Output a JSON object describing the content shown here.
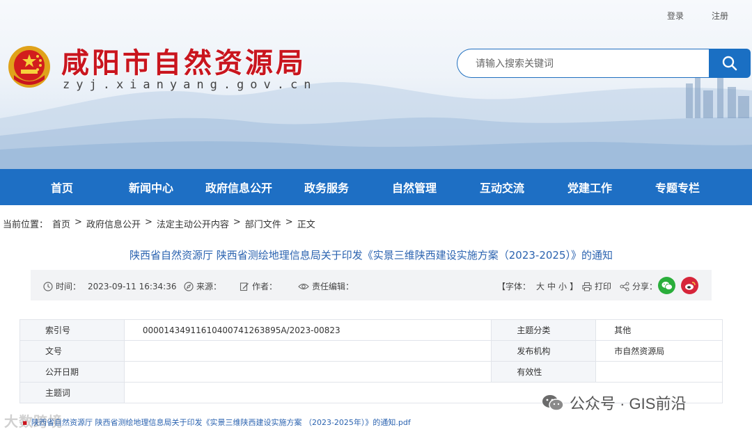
{
  "toplinks": {
    "login": "登录",
    "register": "注册"
  },
  "site": {
    "title": "咸阳市自然资源局",
    "domain": "zyj.xianyang.gov.cn"
  },
  "search": {
    "placeholder": "请输入搜索关键词",
    "icon": "search-icon"
  },
  "nav": {
    "items": [
      "首页",
      "新闻中心",
      "政府信息公开",
      "政务服务",
      "自然管理",
      "互动交流",
      "党建工作",
      "专题专栏"
    ]
  },
  "breadcrumb": {
    "label": "当前位置：",
    "items": [
      "首页",
      "政府信息公开",
      "法定主动公开内容",
      "部门文件",
      "正文"
    ],
    "sep": ">"
  },
  "article": {
    "title": "陕西省自然资源厅 陕西省测绘地理信息局关于印发《实景三维陕西建设实施方案（2023-2025）》的通知",
    "time_label": "时间：",
    "time_value": "2023-09-11 16:34:36",
    "source_label": "来源：",
    "author_label": "作者：",
    "editor_label": "责任编辑：",
    "font_label": "【字体：",
    "font_sizes": [
      "大",
      "中",
      "小"
    ],
    "font_close": "】",
    "print_label": "打印",
    "share_label": "分享："
  },
  "info": {
    "index_label": "索引号",
    "index_value": "000014349116104007412638 95A/2023-00823",
    "doc_label": "文号",
    "doc_value": "",
    "date_label": "公开日期",
    "date_value": "",
    "topic_label": "主题词",
    "topic_value": "",
    "category_label": "主题分类",
    "category_value": "其他",
    "org_label": "发布机构",
    "org_value": "市自然资源局",
    "validity_label": "有效性",
    "validity_value": ""
  },
  "attachment": {
    "text": "陕西省自然资源厅 陕西省测绘地理信息局关于印发《实景三维陕西建设实施方案 （2023-2025年）》的通知.pdf"
  },
  "watermark": {
    "left": "大数跨境",
    "right": "公众号 · GIS前沿"
  },
  "colors": {
    "brand_red": "#c9151e",
    "nav_blue": "#1e6fc4",
    "link_blue": "#2b63b0",
    "wechat_green": "#2aae3b",
    "weibo_red": "#d6253a"
  }
}
